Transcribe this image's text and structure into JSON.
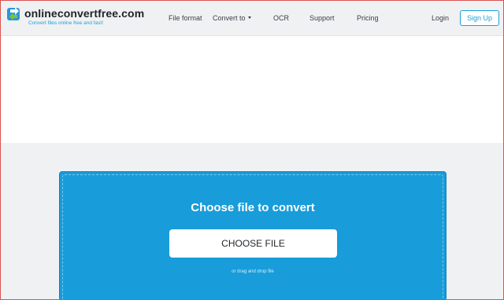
{
  "header": {
    "brand": "onlineconvertfree.com",
    "tagline": "Convert files online free and fast!",
    "nav": {
      "file_format": "File format",
      "convert_to": "Convert to",
      "ocr": "OCR",
      "support": "Support",
      "pricing": "Pricing",
      "login": "Login",
      "signup": "Sign Up"
    }
  },
  "upload": {
    "title": "Choose file to convert",
    "button_label": "CHOOSE FILE",
    "drop_hint": "or drag and drop file"
  },
  "colors": {
    "accent": "#1ea0dc",
    "upload_bg": "#189cda",
    "page_bg": "#f0f1f3",
    "frame_border": "#d9534f"
  },
  "icons": {
    "logo": "convert-arrows-icon",
    "dropdown": "chevron-down-icon"
  }
}
